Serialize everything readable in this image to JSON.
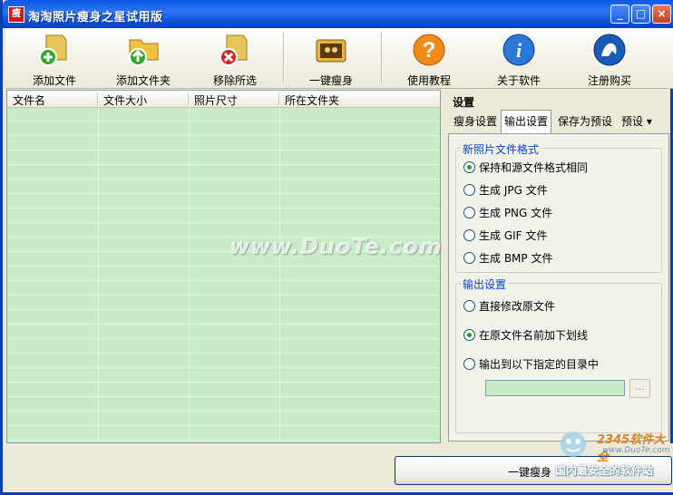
{
  "window": {
    "app_icon_char": "瘦",
    "title": "淘淘照片瘦身之星试用版",
    "minimize_glyph": "_",
    "maximize_glyph": "□",
    "close_glyph": "×"
  },
  "toolbar": {
    "buttons": [
      {
        "label": "添加文件",
        "icon": "add-file-icon"
      },
      {
        "label": "添加文件夹",
        "icon": "add-folder-icon"
      },
      {
        "label": "移除所选",
        "icon": "remove-selected-icon"
      },
      {
        "label": "一键瘦身",
        "icon": "slim-photo-icon"
      },
      {
        "label": "使用教程",
        "icon": "help-icon"
      },
      {
        "label": "关于软件",
        "icon": "info-icon"
      },
      {
        "label": "注册购买",
        "icon": "register-icon"
      }
    ]
  },
  "file_list": {
    "columns": [
      "文件名",
      "文件大小",
      "照片尺寸",
      "所在文件夹"
    ],
    "rows": []
  },
  "watermark": "www.DuoTe.com",
  "settings": {
    "title": "设置",
    "tabs": [
      "瘦身设置",
      "输出设置",
      "保存为预设",
      "预设 ▾"
    ],
    "active_tab": "输出设置",
    "format_group": {
      "title": "新照片文件格式",
      "options": [
        "保持和源文件格式相同",
        "生成 JPG 文件",
        "生成 PNG 文件",
        "生成 GIF 文件",
        "生成 BMP 文件"
      ],
      "selected": "保持和源文件格式相同"
    },
    "output_group": {
      "title": "输出设置",
      "options": [
        "直接修改原文件",
        "在原文件名前加下划线",
        "输出到以下指定的目录中"
      ],
      "selected": "在原文件名前加下划线",
      "directory_value": "",
      "browse_label": "..."
    }
  },
  "bottom": {
    "run_button": "一键瘦身"
  },
  "overlay_logo": {
    "brand": "2345软件大全",
    "url": "www.DuoTe.com",
    "slogan": "国内最安全的软件站"
  },
  "colors": {
    "titlebar": "#0a58e6",
    "list_background": "#c8ecc8",
    "group_title": "#0046d5"
  }
}
